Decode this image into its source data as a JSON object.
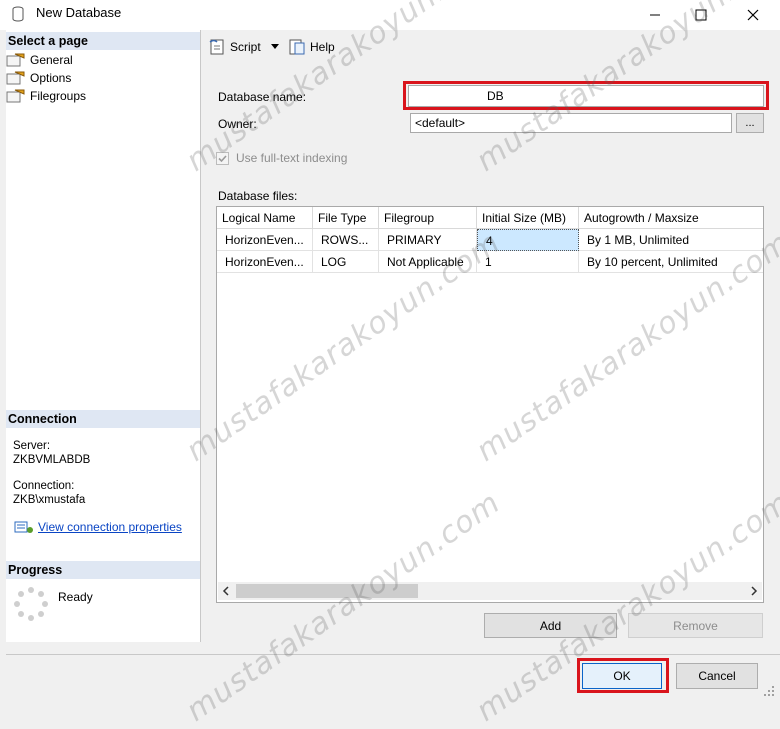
{
  "window": {
    "title": "New Database"
  },
  "left_pane": {
    "select_page_header": "Select a page",
    "pages": [
      {
        "label": "General"
      },
      {
        "label": "Options"
      },
      {
        "label": "Filegroups"
      }
    ],
    "connection_header": "Connection",
    "server_label": "Server:",
    "server_value": "ZKBVMLABDB",
    "connection_label": "Connection:",
    "connection_value": "ZKB\\xmustafa",
    "view_connection_link": "View connection properties",
    "progress_header": "Progress",
    "progress_status": "Ready"
  },
  "toolbar": {
    "script_label": "Script",
    "help_label": "Help"
  },
  "form": {
    "database_name_label": "Database name:",
    "database_name_value": "DB",
    "owner_label": "Owner:",
    "owner_value": "<default>",
    "browse_label": "...",
    "fulltext_label": "Use full-text indexing",
    "database_files_label": "Database files:"
  },
  "grid": {
    "columns": [
      "Logical Name",
      "File Type",
      "Filegroup",
      "Initial Size (MB)",
      "Autogrowth / Maxsize"
    ],
    "rows": [
      [
        "HorizonEven...",
        "ROWS...",
        "PRIMARY",
        "4",
        "By 1 MB, Unlimited"
      ],
      [
        "HorizonEven...",
        "LOG",
        "Not Applicable",
        "1",
        "By 10 percent, Unlimited"
      ]
    ]
  },
  "buttons": {
    "add": "Add",
    "remove": "Remove",
    "ok": "OK",
    "cancel": "Cancel"
  },
  "watermark": {
    "text": "mustafakarakoyun.com"
  },
  "colors": {
    "accent_red": "#d9141c",
    "section_header_bg": "#dfe7f3",
    "link_blue": "#0a45c4",
    "selected_cell": "#cce8ff"
  }
}
